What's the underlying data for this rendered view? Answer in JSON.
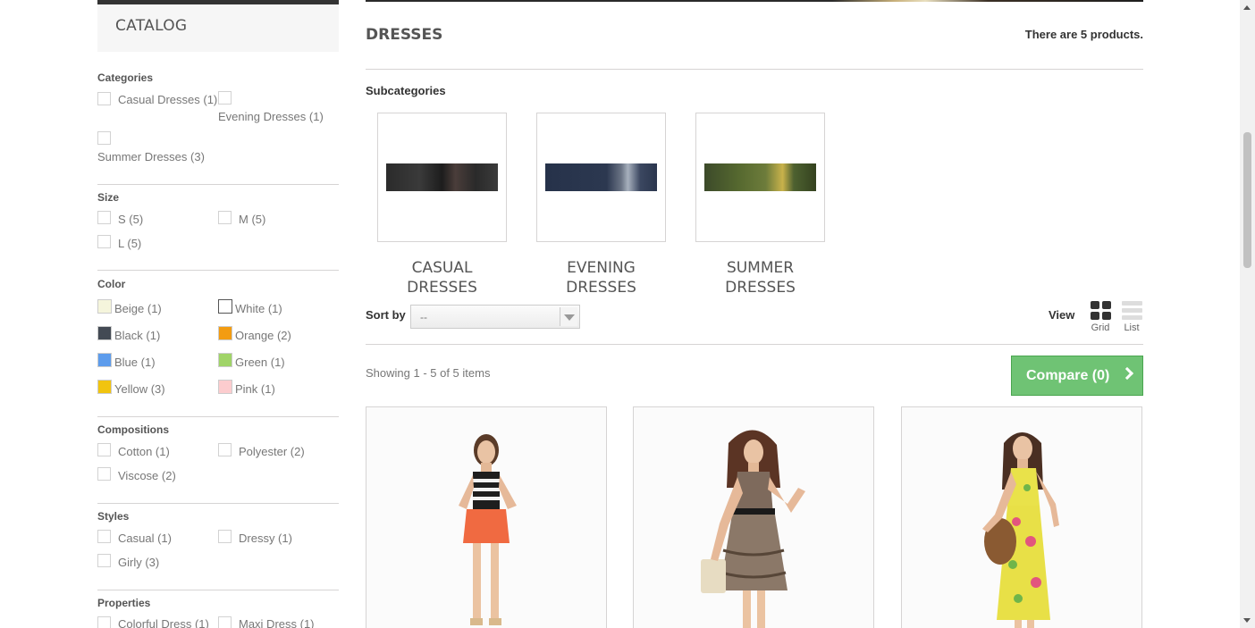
{
  "sidebar": {
    "catalog_title": "CATALOG",
    "filters": {
      "categories": {
        "title": "Categories",
        "items": [
          "Casual Dresses (1)",
          "Evening Dresses (1)",
          "Summer Dresses (3)"
        ]
      },
      "size": {
        "title": "Size",
        "items": [
          "S (5)",
          "M (5)",
          "L (5)"
        ]
      },
      "color": {
        "title": "Color",
        "items": [
          {
            "label": "Beige (1)",
            "color": "#f5f5dc"
          },
          {
            "label": "White (1)",
            "color": "#ffffff"
          },
          {
            "label": "Black (1)",
            "color": "#434a54"
          },
          {
            "label": "Orange (2)",
            "color": "#f39c11"
          },
          {
            "label": "Blue (1)",
            "color": "#5d9cec"
          },
          {
            "label": "Green (1)",
            "color": "#a0d468"
          },
          {
            "label": "Yellow (3)",
            "color": "#f1c40f"
          },
          {
            "label": "Pink (1)",
            "color": "#fcccce"
          }
        ]
      },
      "compositions": {
        "title": "Compositions",
        "items": [
          "Cotton (1)",
          "Polyester (2)",
          "Viscose (2)"
        ]
      },
      "styles": {
        "title": "Styles",
        "items": [
          "Casual (1)",
          "Dressy (1)",
          "Girly (3)"
        ]
      },
      "properties": {
        "title": "Properties",
        "items": [
          "Colorful Dress (1)",
          "Maxi Dress (1)"
        ]
      }
    }
  },
  "main": {
    "category_title": "DRESSES",
    "product_count": "There are 5 products.",
    "subcategories_label": "Subcategories",
    "subcategories": [
      {
        "name": "CASUAL DRESSES"
      },
      {
        "name": "EVENING DRESSES"
      },
      {
        "name": "SUMMER DRESSES"
      }
    ],
    "sort_by_label": "Sort by",
    "sort_value": "--",
    "view_label": "View",
    "view_grid": "Grid",
    "view_list": "List",
    "showing": "Showing 1 - 5 of 5 items",
    "compare_label": "Compare (0)"
  },
  "colors": {
    "compare_green": "#6fc374",
    "border": "#d6d4d4"
  }
}
